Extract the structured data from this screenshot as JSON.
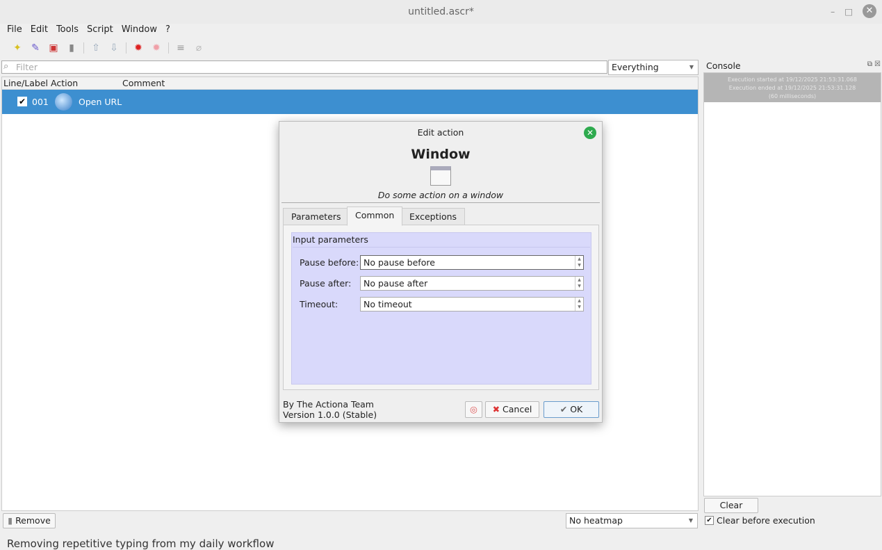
{
  "window": {
    "title": "untitled.ascr*",
    "minimize": "–",
    "maximize": "□",
    "close": "✕"
  },
  "menu": [
    "File",
    "Edit",
    "Tools",
    "Script",
    "Window",
    "?"
  ],
  "filter": {
    "placeholder": "Filter",
    "scope": "Everything"
  },
  "table": {
    "headers": [
      "Line/Label",
      "Action",
      "Comment"
    ],
    "rows": [
      {
        "checked": true,
        "line": "001",
        "action": "Open URL",
        "comment": ""
      }
    ]
  },
  "console": {
    "title": "Console",
    "messages": [
      "Execution started at 19/12/2025 21:53:31.068",
      "Execution ended at 19/12/2025 21:53:31.128",
      "(60 milliseconds)"
    ],
    "clear_label": "Clear",
    "clear_before_label": "Clear before execution",
    "clear_before_checked": true
  },
  "bottom": {
    "remove_label": "Remove",
    "heatmap": "No heatmap"
  },
  "dialog": {
    "title": "Edit action",
    "action_name": "Window",
    "description": "Do some action on a window",
    "tabs": [
      "Parameters",
      "Common",
      "Exceptions"
    ],
    "active_tab": "Common",
    "group_title": "Input parameters",
    "fields": [
      {
        "label": "Pause before:",
        "value": "No pause before"
      },
      {
        "label": "Pause after:",
        "value": "No pause after"
      },
      {
        "label": "Timeout:",
        "value": "No timeout"
      }
    ],
    "author": "By The Actiona Team",
    "version": "Version 1.0.0 (Stable)",
    "cancel_label": "Cancel",
    "ok_label": "OK"
  },
  "caption": "Removing repetitive typing from my daily workflow"
}
